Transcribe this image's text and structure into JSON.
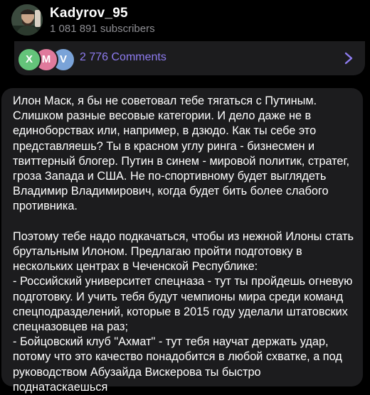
{
  "channel": {
    "name": "Kadyrov_95",
    "subscribers": "1 081 891 subscribers"
  },
  "comments": {
    "avatars": [
      "X",
      "M",
      "V"
    ],
    "label": "2 776 Comments"
  },
  "post": {
    "paragraph1": "Илон Маск, я бы не советовал тебе тягаться с Путиным. Слишком разные весовые категории. И дело даже не в единоборствах или, например, в дзюдо. Как ты себе это представляешь? Ты в красном углу ринга - бизнесмен и твиттерный блогер. Путин в синем - мировой политик, стратег, гроза Запада и США. Не по-спортивному будет выглядеть Владимир Владимирович, когда будет бить более слабого противника.",
    "paragraph2": "Поэтому тебе надо подкачаться, чтобы из нежной Илоны стать брутальным Илоном. Предлагаю пройти подготовку в нескольких центрах в Чеченской Республике:\n- Российский университет спецназа - тут ты пройдешь огневую подготовку. И учить тебя будут чемпионы мира среди команд спецподразделений, которые в 2015 году уделали штатовских спецназовцев на раз;\n- Бойцовский клуб \"Ахмат\" - тут тебя научат держать удар, потому что это качество понадобится в любой схватке, а под руководством Абузайда Вискерова ты быстро поднатаскаешься"
  },
  "colors": {
    "background": "#000000",
    "bubble": "#1c1c1e",
    "accent": "#8e7cf0",
    "secondary_text": "#8e8e93"
  }
}
